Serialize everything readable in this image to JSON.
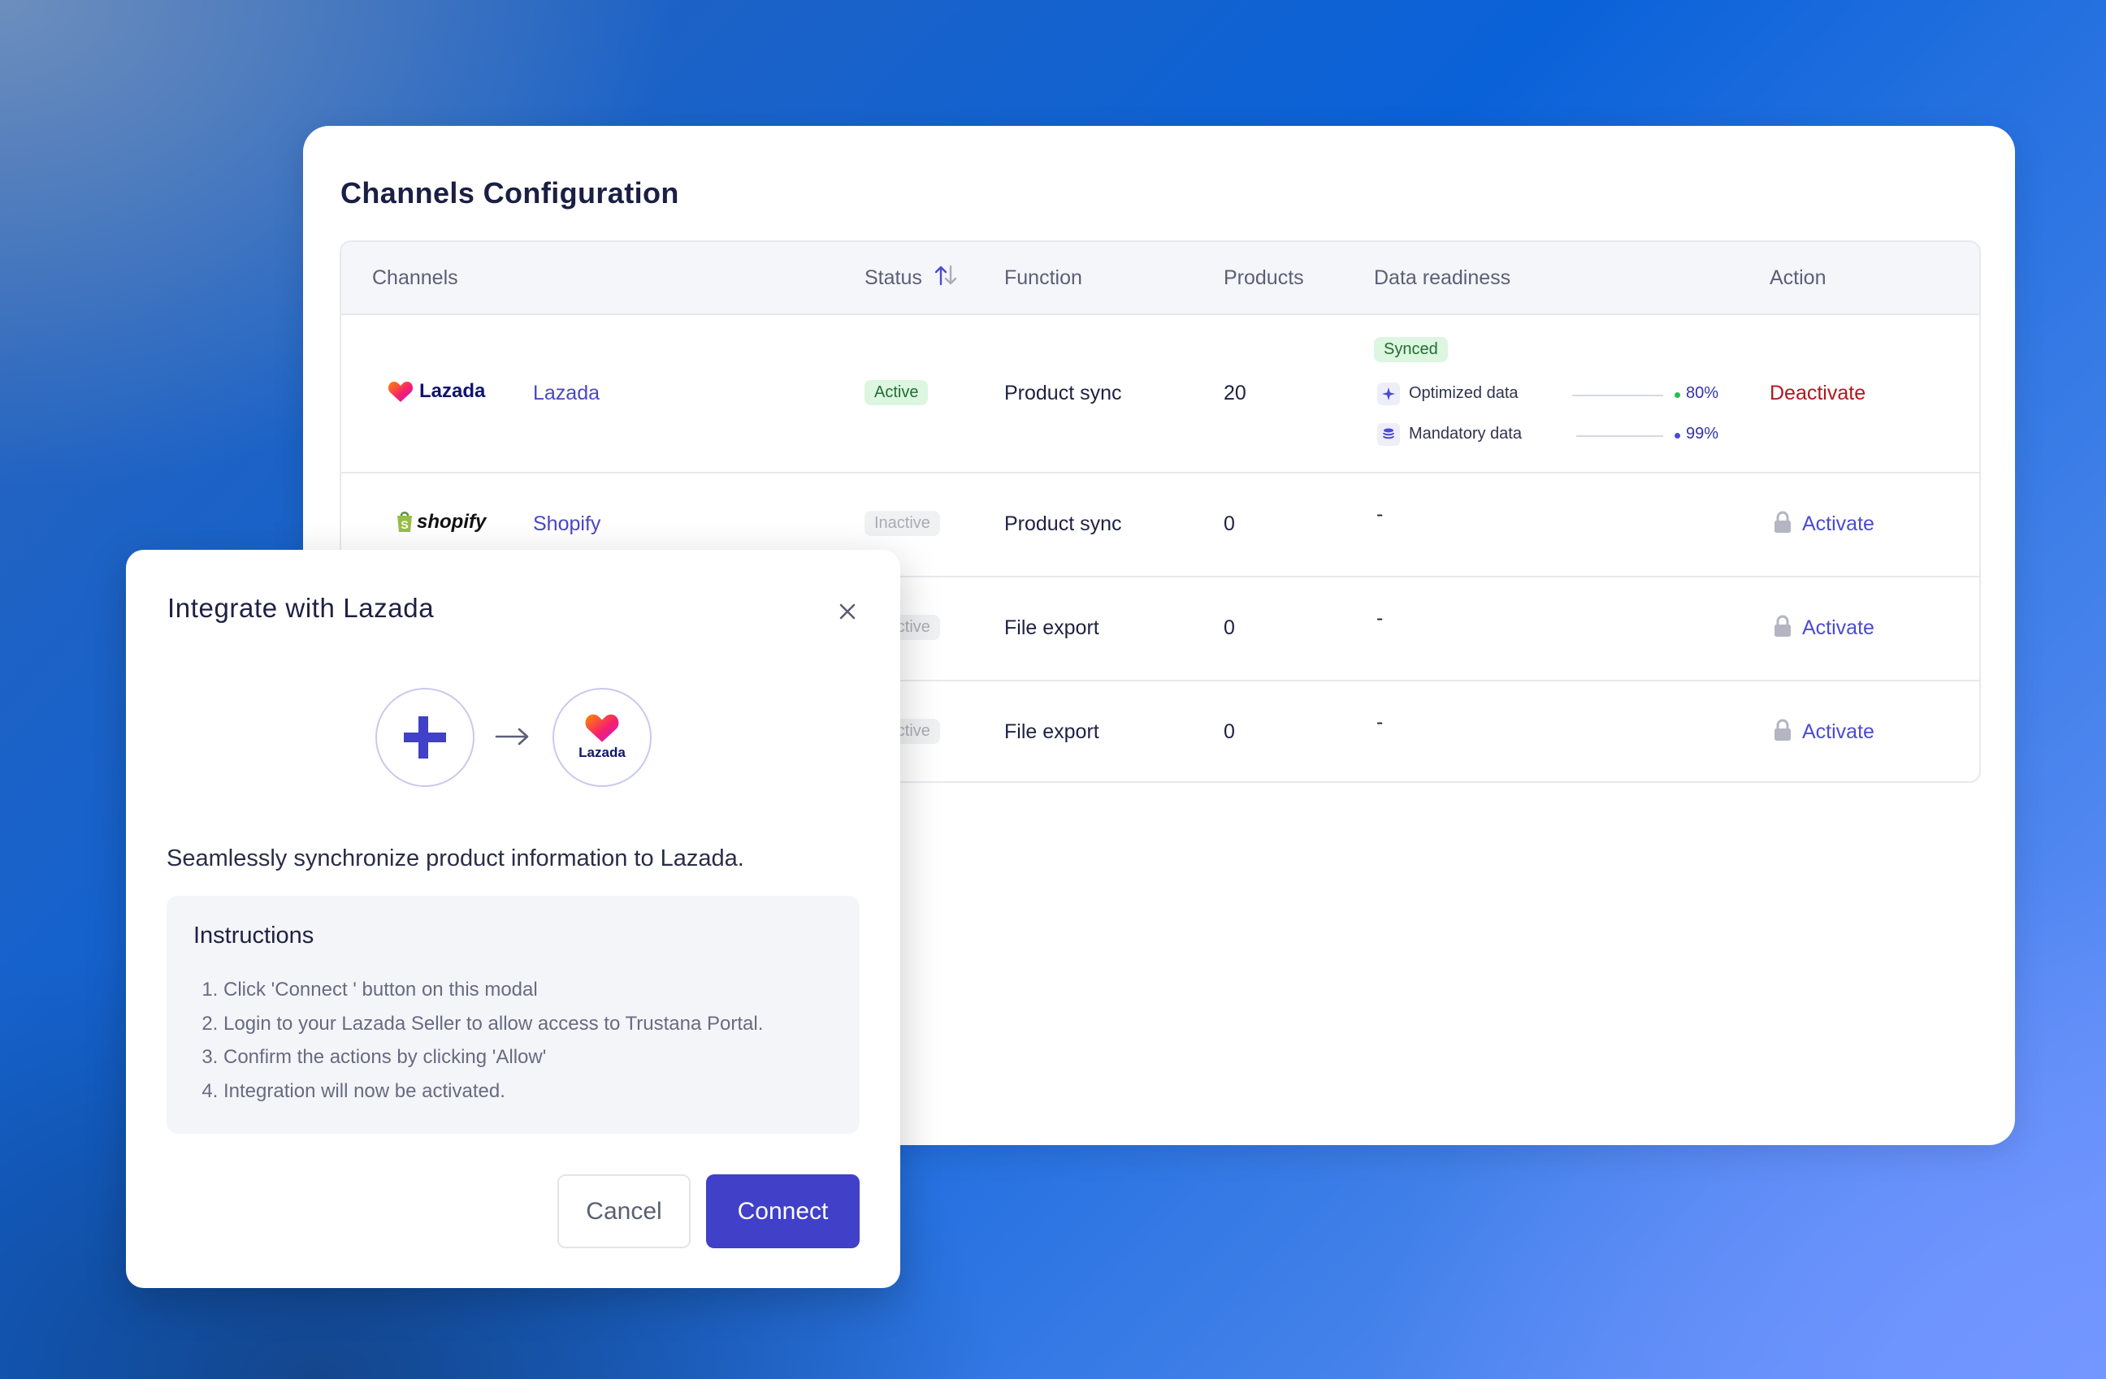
{
  "page": {
    "title": "Channels Configuration"
  },
  "table": {
    "headers": {
      "channels": "Channels",
      "status": "Status",
      "function": "Function",
      "products": "Products",
      "data_readiness": "Data readiness",
      "action": "Action"
    },
    "rows": [
      {
        "logo": "Lazada",
        "channel": "Lazada",
        "status": "Active",
        "function": "Product sync",
        "products": "20",
        "readiness": {
          "badge": "Synced",
          "optimized_label": "Optimized data",
          "optimized_pct": "80%",
          "mandatory_label": "Mandatory data",
          "mandatory_pct": "99%"
        },
        "action": "Deactivate"
      },
      {
        "logo": "shopify",
        "channel": "Shopify",
        "status": "Inactive",
        "function": "Product sync",
        "products": "0",
        "readiness_text": "-",
        "action": "Activate"
      },
      {
        "status": "Inactive",
        "function": "File export",
        "products": "0",
        "readiness_text": "-",
        "action": "Activate"
      },
      {
        "status": "Inactive",
        "function": "File export",
        "products": "0",
        "readiness_text": "-",
        "action": "Activate"
      }
    ]
  },
  "modal": {
    "title": "Integrate with Lazada",
    "target_logo_text": "Lazada",
    "description": "Seamlessly synchronize product information to Lazada.",
    "instructions_title": "Instructions",
    "steps": [
      "Click 'Connect ' button on this modal",
      "Login to  your Lazada Seller to allow access to Trustana Portal.",
      "Confirm the actions by clicking 'Allow'",
      "Integration will now be activated."
    ],
    "cancel_label": "Cancel",
    "connect_label": "Connect"
  },
  "colors": {
    "primary": "#4040c8",
    "link": "#4a47c4",
    "danger": "#b3171f",
    "success_bg": "#dcf6e0",
    "success_text": "#236c34"
  },
  "icons": {
    "sort": "sort-arrows-icon",
    "lock": "lock-icon",
    "close": "close-icon",
    "arrow": "arrow-right-icon",
    "optimized": "sparkle-icon",
    "mandatory": "database-icon"
  }
}
